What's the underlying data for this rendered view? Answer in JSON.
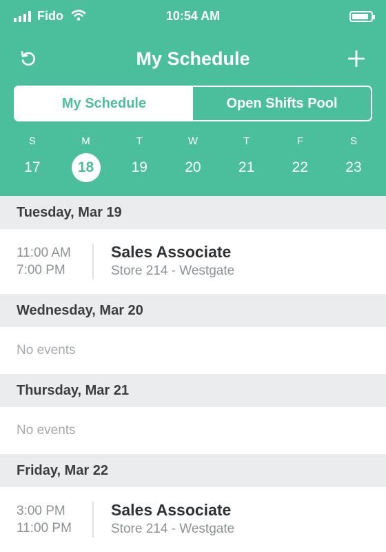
{
  "status_bar": {
    "carrier": "Fido",
    "time": "10:54 AM",
    "battery_level": 0.9
  },
  "header": {
    "title": "My Schedule",
    "icons": {
      "refresh": "refresh-icon",
      "add": "plus-icon"
    },
    "tabs": [
      {
        "label": "My Schedule",
        "active": true
      },
      {
        "label": "Open Shifts Pool",
        "active": false
      }
    ],
    "week": [
      {
        "dow": "S",
        "date": "17",
        "selected": false
      },
      {
        "dow": "M",
        "date": "18",
        "selected": true
      },
      {
        "dow": "T",
        "date": "19",
        "selected": false
      },
      {
        "dow": "W",
        "date": "20",
        "selected": false
      },
      {
        "dow": "T",
        "date": "21",
        "selected": false
      },
      {
        "dow": "F",
        "date": "22",
        "selected": false
      },
      {
        "dow": "S",
        "date": "23",
        "selected": false
      }
    ]
  },
  "agenda": {
    "days": [
      {
        "header": "Tuesday, Mar 19",
        "shifts": [
          {
            "start": "11:00 AM",
            "end": "7:00 PM",
            "role": "Sales Associate",
            "location": "Store 214 - Westgate"
          }
        ],
        "empty_text": ""
      },
      {
        "header": "Wednesday, Mar 20",
        "shifts": [],
        "empty_text": "No events"
      },
      {
        "header": "Thursday, Mar 21",
        "shifts": [],
        "empty_text": "No events"
      },
      {
        "header": "Friday, Mar 22",
        "shifts": [
          {
            "start": "3:00 PM",
            "end": "11:00 PM",
            "role": "Sales Associate",
            "location": "Store 214 - Westgate"
          }
        ],
        "empty_text": ""
      }
    ]
  },
  "colors": {
    "accent": "#4bbf9c",
    "section_bg": "#ebeced",
    "text_dark": "#2f3235",
    "text_muted": "#8c9194"
  }
}
